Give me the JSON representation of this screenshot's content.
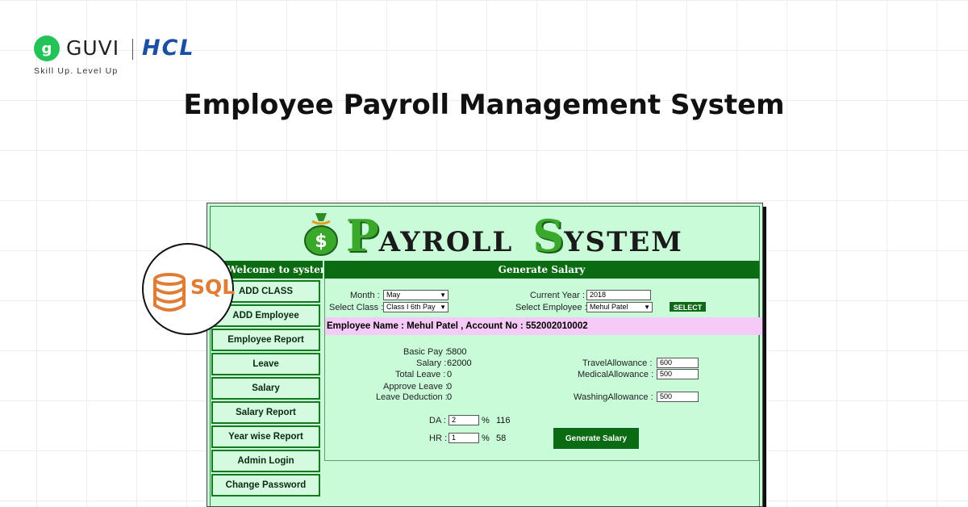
{
  "brand": {
    "guvi_icon_letter": "g",
    "guvi": "GUVI",
    "hcl": "HCL",
    "tagline": "Skill Up. Level Up"
  },
  "page_title": "Employee Payroll Management System",
  "app": {
    "banner": {
      "p_cap": "P",
      "p_rest": "AYROLL",
      "s_cap": "S",
      "s_rest": "YSTEM"
    },
    "sidebar": {
      "header": "Welcome to system",
      "items": [
        "ADD CLASS",
        "ADD Employee",
        "Employee Report",
        "Leave",
        "Salary",
        "Salary Report",
        "Year wise Report",
        "Admin Login",
        "Change Password"
      ]
    },
    "main": {
      "header": "Generate Salary",
      "month_label": "Month :",
      "month_value": "May",
      "current_year_label": "Current Year :",
      "current_year_value": "2018",
      "class_label": "Select Class :",
      "class_value": "Class I 6th Pay",
      "employee_label": "Select Employee :",
      "employee_value": "Mehul Patel",
      "select_button": "SELECT",
      "employee_info": "Employee Name : Mehul Patel  , Account No : 552002010002",
      "basic_pay_label": "Basic Pay :",
      "basic_pay_value": "5800",
      "salary_label": "Salary :",
      "salary_value": "62000",
      "total_leave_label": "Total Leave :",
      "total_leave_value": "0",
      "approve_leave_label": "Approve Leave :",
      "approve_leave_value": "0",
      "leave_deduction_label": "Leave Deduction :",
      "leave_deduction_value": "0",
      "travel_label": "TravelAllowance :",
      "travel_value": "600",
      "medical_label": "MedicalAllowance :",
      "medical_value": "500",
      "washing_label": "WashingAllowance :",
      "washing_value": "500",
      "da_label": "DA :",
      "da_value": "2",
      "da_amount": "116",
      "hr_label": "HR :",
      "hr_value": "1",
      "hr_amount": "58",
      "percent": "%",
      "generate_button": "Generate Salary"
    }
  },
  "sql_badge": "SQL",
  "colors": {
    "app_bg": "#c9fbd9",
    "header_green": "#0b6b12",
    "employee_bar": "#f5c9f8",
    "sql_orange": "#e07c34",
    "guvi_green": "#24c35a",
    "hcl_blue": "#1a4fa3"
  }
}
